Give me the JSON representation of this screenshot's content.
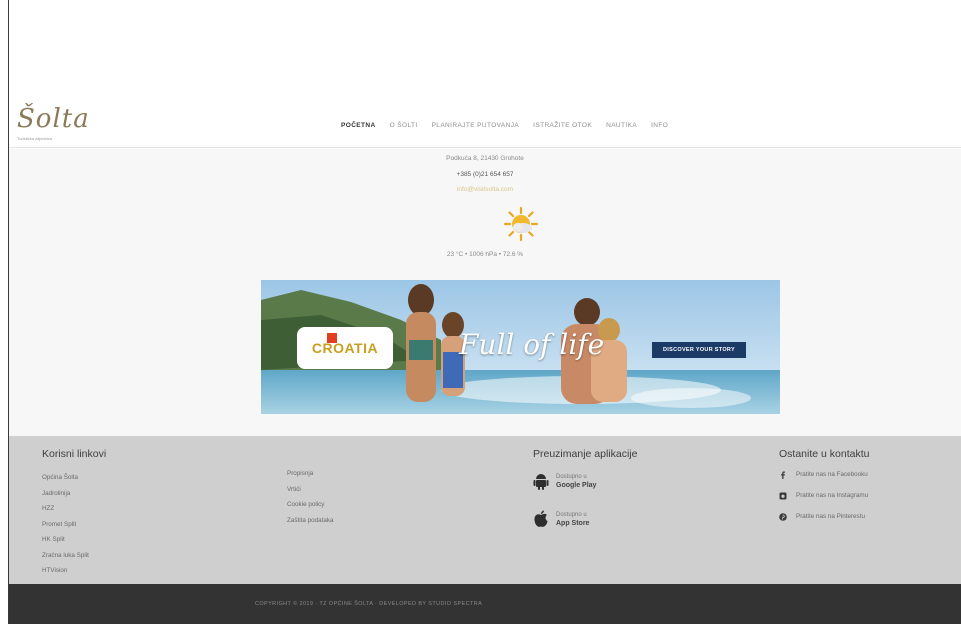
{
  "logo": {
    "word": "Šolta",
    "subtitle": "Turistička zajednica"
  },
  "nav": {
    "items": [
      {
        "label": "POČETNA",
        "active": true
      },
      {
        "label": "O ŠOLTI",
        "active": false
      },
      {
        "label": "PLANIRAJTE PUTOVANJA",
        "active": false
      },
      {
        "label": "ISTRAŽITE OTOK",
        "active": false
      },
      {
        "label": "NAUTIKA",
        "active": false
      },
      {
        "label": "INFO",
        "active": false
      }
    ]
  },
  "info": {
    "address": "Podkuća 8, 21430 Grohote",
    "phone": "+385 (0)21 654 657",
    "email": "info@visitsolta.com",
    "weather_icon": "sun-cloud-icon",
    "weather_text": "23 °C • 1006 hPa • 72.6 %"
  },
  "banner": {
    "brand": "CROATIA",
    "slogan": "Full of life",
    "cta_label": "DISCOVER YOUR STORY"
  },
  "footer": {
    "useful_links": {
      "title": "Korisni linkovi",
      "items": [
        "Općina Šolta",
        "Jadrolinija",
        "HZZ",
        "Promet Split",
        "HK Split",
        "Zračna luka Split",
        "HTVision"
      ]
    },
    "more_links": {
      "items": [
        "Propisnja",
        "Vrtići",
        "Cookie policy",
        "Zaštita podataka"
      ]
    },
    "apps": {
      "title": "Preuzimanje aplikacije",
      "items": [
        {
          "icon": "android-icon",
          "top": "Dostupno u",
          "store": "Google Play"
        },
        {
          "icon": "apple-icon",
          "top": "Dostupno u",
          "store": "App Store"
        }
      ]
    },
    "contact": {
      "title": "Ostanite u kontaktu",
      "items": [
        {
          "icon": "facebook-icon",
          "label": "Pratite nas na Facebooku"
        },
        {
          "icon": "instagram-icon",
          "label": "Pratite nas na Instagramu"
        },
        {
          "icon": "pinterest-icon",
          "label": "Pratite nas na Pinterestu"
        }
      ]
    }
  },
  "copyright": "COPYRIGHT © 2019 · TZ OPĆINE ŠOLTA · DEVELOPED BY STUDIO SPECTRA",
  "colors": {
    "header_bg": "#ffffff",
    "info_bg": "#f7f7f7",
    "footer_bg": "#cfcfcf",
    "bottombar_bg": "#333333",
    "cta_bg": "#1b3a66",
    "email_accent": "#d8c48a"
  }
}
